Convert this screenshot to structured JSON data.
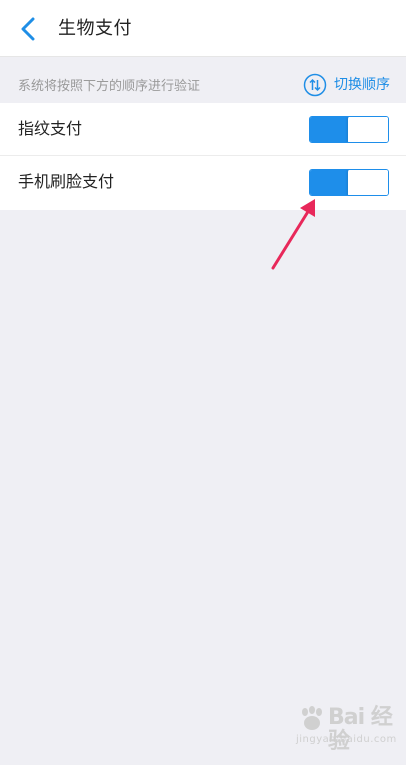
{
  "header": {
    "back_icon": "chevron-left-icon",
    "title": "生物支付"
  },
  "info_bar": {
    "text": "系统将按照下方的顺序进行验证",
    "switch_order_icon": "swap-vertical-circle-icon",
    "switch_order_label": "切换顺序"
  },
  "items": [
    {
      "label": "指纹支付",
      "enabled": true
    },
    {
      "label": "手机刷脸支付",
      "enabled": true
    }
  ],
  "watermark": {
    "main": "Bai 经验",
    "sub": "jingyan.baidu.com"
  },
  "colors": {
    "accent": "#1e8eea",
    "background": "#efeff4",
    "annotation_arrow": "#e8285a"
  }
}
